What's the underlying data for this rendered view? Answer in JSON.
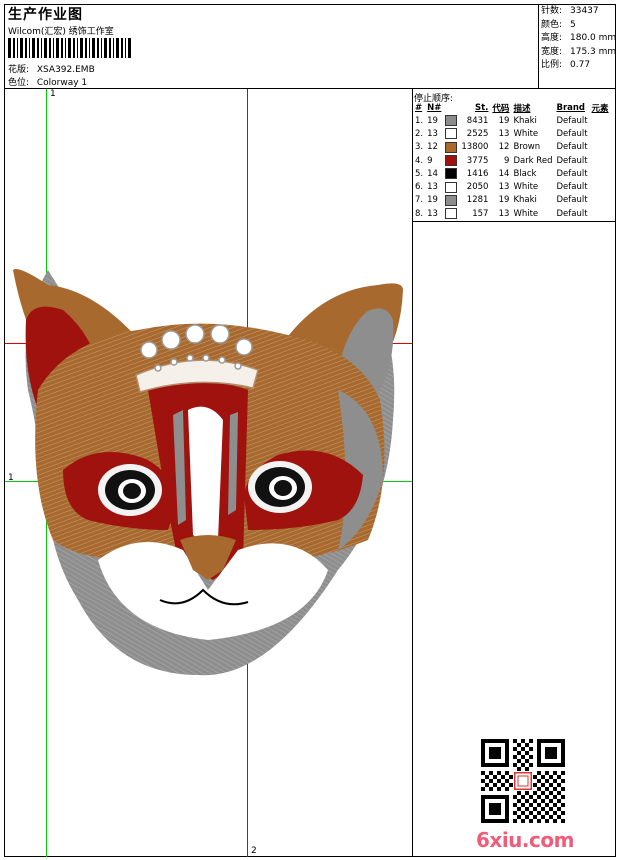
{
  "header": {
    "title": "生产作业图",
    "studio": "Wilcom(汇宏) 绣饰工作室",
    "design": {
      "label": "花版:",
      "value": "XSA392.EMB"
    },
    "colorway": {
      "label": "色位:",
      "value": "Colorway 1"
    }
  },
  "stats": [
    {
      "label": "针数:",
      "value": "33437"
    },
    {
      "label": "颜色:",
      "value": "5"
    },
    {
      "label": "高度:",
      "value": "180.0 mm"
    },
    {
      "label": "宽度:",
      "value": "175.3 mm"
    },
    {
      "label": "比例:",
      "value": "0.77"
    }
  ],
  "stop_sequence": {
    "title": "停止顺序:",
    "columns": [
      "#",
      "N#",
      "St.",
      "代码",
      "描述",
      "Brand",
      "元素"
    ],
    "rows": [
      {
        "idx": "1.",
        "n": "19",
        "color": "#8c8c8c",
        "st": "8431",
        "code": "19",
        "desc": "Khaki",
        "brand": "Default"
      },
      {
        "idx": "2.",
        "n": "13",
        "color": "#ffffff",
        "st": "2525",
        "code": "13",
        "desc": "White",
        "brand": "Default"
      },
      {
        "idx": "3.",
        "n": "12",
        "color": "#a8692e",
        "st": "13800",
        "code": "12",
        "desc": "Brown",
        "brand": "Default"
      },
      {
        "idx": "4.",
        "n": "9",
        "color": "#a0120e",
        "st": "3775",
        "code": "9",
        "desc": "Dark Red",
        "brand": "Default"
      },
      {
        "idx": "5.",
        "n": "14",
        "color": "#000000",
        "st": "1416",
        "code": "14",
        "desc": "Black",
        "brand": "Default"
      },
      {
        "idx": "6.",
        "n": "13",
        "color": "#ffffff",
        "st": "2050",
        "code": "13",
        "desc": "White",
        "brand": "Default"
      },
      {
        "idx": "7.",
        "n": "19",
        "color": "#8c8c8c",
        "st": "1281",
        "code": "19",
        "desc": "Khaki",
        "brand": "Default"
      },
      {
        "idx": "8.",
        "n": "13",
        "color": "#ffffff",
        "st": "157",
        "code": "13",
        "desc": "White",
        "brand": "Default"
      }
    ]
  },
  "guides": {
    "v1": "1",
    "h1": "1",
    "v2": "2"
  },
  "watermark": "6xiu.com",
  "colors": {
    "guide_green": "#00cc00",
    "guide_red": "#e00000",
    "watermark": "#f05c7a"
  }
}
